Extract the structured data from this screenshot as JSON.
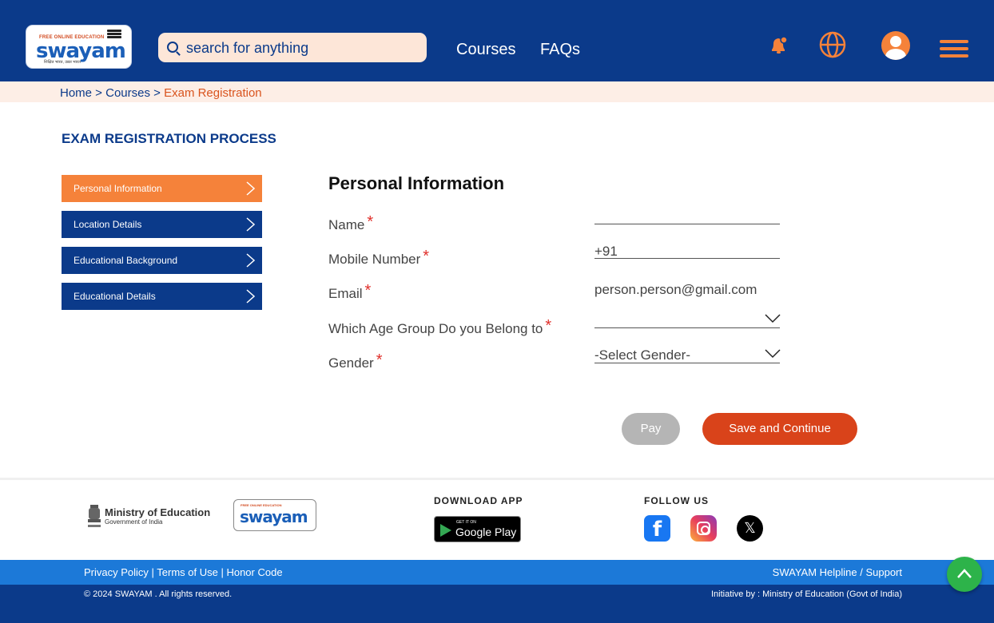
{
  "header": {
    "logo": {
      "top_text": "FREE ONLINE EDUCATION",
      "word": "swayam",
      "tagline": "शिक्षित भारत, उन्नत भारत"
    },
    "search": {
      "placeholder": "search for anything"
    },
    "nav": {
      "courses": "Courses",
      "faqs": "FAQs"
    },
    "icons": [
      "bell-icon",
      "globe-icon",
      "user-avatar-icon",
      "menu-icon"
    ],
    "accent_color": "#f5823a",
    "brand_color": "#0b3a8a"
  },
  "breadcrumb": {
    "home": "Home",
    "sep": " > ",
    "courses": "Courses",
    "current": "Exam Registration"
  },
  "main": {
    "section_title": "EXAM REGISTRATION PROCESS",
    "steps": [
      {
        "label": "Personal Information",
        "active": true
      },
      {
        "label": "Location Details",
        "active": false
      },
      {
        "label": "Educational Background",
        "active": false
      },
      {
        "label": "Educational Details",
        "active": false
      }
    ],
    "form": {
      "title": "Personal Information",
      "required_marker": "*",
      "fields": {
        "name": {
          "label": "Name",
          "value": ""
        },
        "mobile": {
          "label": "Mobile Number",
          "value": "+91"
        },
        "email": {
          "label": "Email",
          "value": "person.person@gmail.com"
        },
        "age_group": {
          "label": "Which Age Group Do you Belong to",
          "value": ""
        },
        "gender": {
          "label": "Gender",
          "value": "-Select Gender-"
        }
      }
    },
    "buttons": {
      "pay": "Pay",
      "save": "Save and Continue"
    }
  },
  "footer": {
    "ministry": {
      "title": "Ministry of Education",
      "subtitle": "Government of India"
    },
    "logo": {
      "top_text": "FREE ONLINE EDUCATION",
      "word": "swayam"
    },
    "download": {
      "title": "DOWNLOAD APP",
      "store_small": "GET IT ON",
      "store_big": "Google Play"
    },
    "follow": {
      "title": "FOLLOW US",
      "icons": [
        "facebook-icon",
        "instagram-icon",
        "x-icon"
      ]
    },
    "links": "Privacy Policy | Terms of Use | Honor Code",
    "helpline": "SWAYAM Helpline / Support",
    "copyright": "© 2024 SWAYAM . All rights reserved.",
    "initiative": "Initiative by : Ministry of Education (Govt of India)"
  }
}
